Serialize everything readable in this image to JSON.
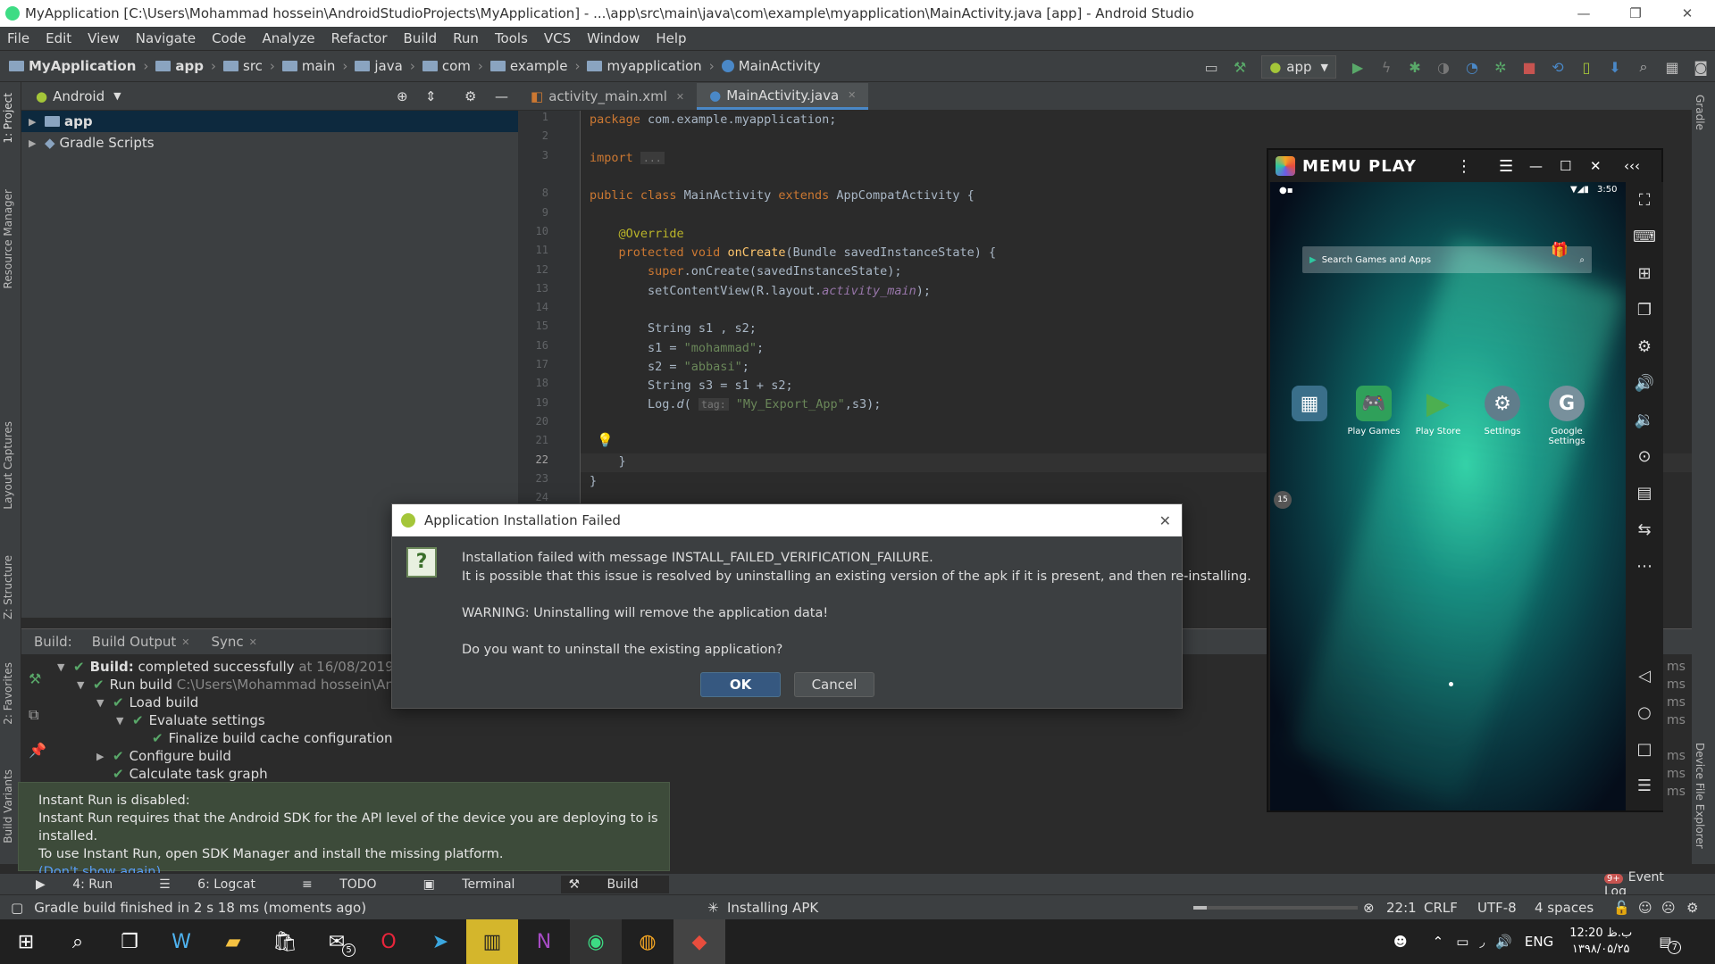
{
  "window": {
    "title": "MyApplication [C:\\Users\\Mohammad hossein\\AndroidStudioProjects\\MyApplication] - ...\\app\\src\\main\\java\\com\\example\\myapplication\\MainActivity.java [app] - Android Studio"
  },
  "menu": [
    "File",
    "Edit",
    "View",
    "Navigate",
    "Code",
    "Analyze",
    "Refactor",
    "Build",
    "Run",
    "Tools",
    "VCS",
    "Window",
    "Help"
  ],
  "breadcrumbs": [
    "MyApplication",
    "app",
    "src",
    "main",
    "java",
    "com",
    "example",
    "myapplication",
    "MainActivity"
  ],
  "run_config": "app",
  "project": {
    "view": "Android",
    "items": [
      "app",
      "Gradle Scripts"
    ]
  },
  "left_strip": [
    "1: Project",
    "Resource Manager",
    "Layout Captures",
    "Z: Structure",
    "2: Favorites",
    "Build Variants"
  ],
  "right_strip": [
    "Gradle",
    "Device File Explorer"
  ],
  "editor": {
    "tabs": [
      "activity_main.xml",
      "MainActivity.java"
    ]
  },
  "build": {
    "tabs": [
      "Build:",
      "Build Output",
      "Sync"
    ],
    "rows": [
      {
        "label": "Build:",
        "text": "completed successfully",
        "time": "at 16/08/2019 12:2"
      },
      {
        "label": "Run build",
        "path": "C:\\Users\\Mohammad hossein\\Andro"
      },
      {
        "label": "Load build"
      },
      {
        "label": "Evaluate settings"
      },
      {
        "label": "Finalize build cache configuration"
      },
      {
        "label": "Configure build"
      },
      {
        "label": "Calculate task graph"
      }
    ],
    "ms": "ms"
  },
  "instant_run": {
    "title": "Instant Run is disabled:",
    "line1": "Instant Run requires that the Android SDK for the API level of the device you are deploying to is installed.",
    "line2": "To use Instant Run, open SDK Manager and install the missing platform.",
    "link": "(Don't show again)"
  },
  "bottom_tabs": [
    "4: Run",
    "6: Logcat",
    "TODO",
    "Terminal",
    "Build"
  ],
  "event_log": "Event Log",
  "event_badge": "9+",
  "status": {
    "message": "Gradle build finished in 2 s 18 ms (moments ago)",
    "progress": "Installing APK",
    "position": "22:1",
    "line_sep": "CRLF",
    "encoding": "UTF-8",
    "indent": "4 spaces"
  },
  "dialog": {
    "title": "Application Installation Failed",
    "line1": "Installation failed with message INSTALL_FAILED_VERIFICATION_FAILURE.",
    "line2": "It is possible that this issue is resolved by uninstalling an existing version of the apk if it is present, and then re-installing.",
    "line3": "WARNING: Uninstalling will remove the application data!",
    "line4": "Do you want to uninstall the existing application?",
    "ok": "OK",
    "cancel": "Cancel"
  },
  "memu": {
    "brand": "MEMU PLAY",
    "time": "3:50",
    "search": "Search Games and Apps",
    "apps": [
      "Play Games",
      "Play Store",
      "Settings",
      "Google Settings"
    ],
    "badge": "15"
  },
  "taskbar": {
    "lang": "ENG",
    "time": "12:20 ب.ظ",
    "date": "۱۳۹۸/۰۵/۲۵",
    "mail_count": "5",
    "notif_count": "7"
  }
}
